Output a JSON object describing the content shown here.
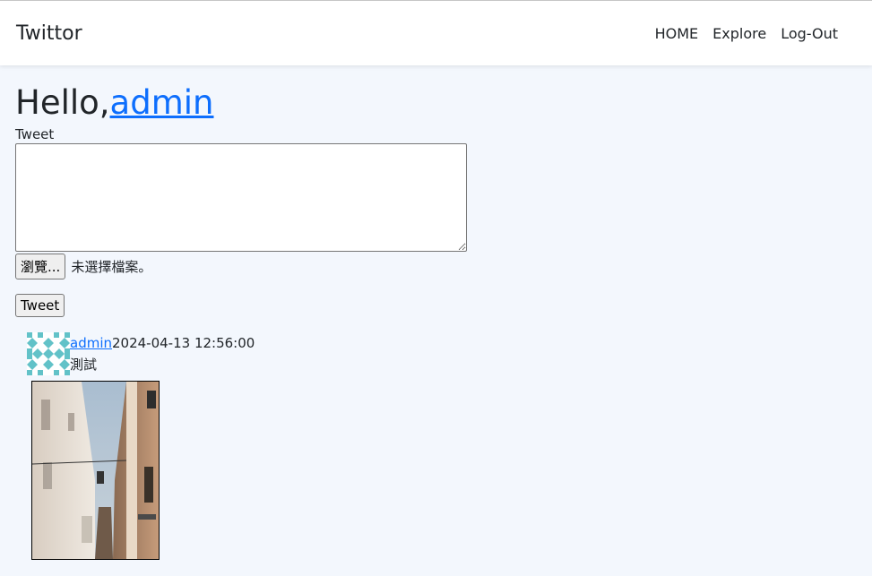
{
  "navbar": {
    "brand": "Twittor",
    "links": [
      "HOME",
      "Explore",
      "Log-Out"
    ]
  },
  "greeting": {
    "prefix": "Hello,",
    "username": "admin"
  },
  "form": {
    "tweet_label": "Tweet",
    "textarea_value": "",
    "file_button_label": "瀏覽...",
    "file_status": "未選擇檔案。",
    "submit_label": "Tweet"
  },
  "tweets": [
    {
      "author": "admin",
      "timestamp": "2024-04-13 12:56:00",
      "body": "測試",
      "avatar_icon": "identicon-avatar-icon",
      "image_subject": "narrow alley photo"
    }
  ],
  "colors": {
    "link": "#0d6efd",
    "page_bg": "#f3f7fd",
    "avatar_teal": "#62c2c8"
  }
}
